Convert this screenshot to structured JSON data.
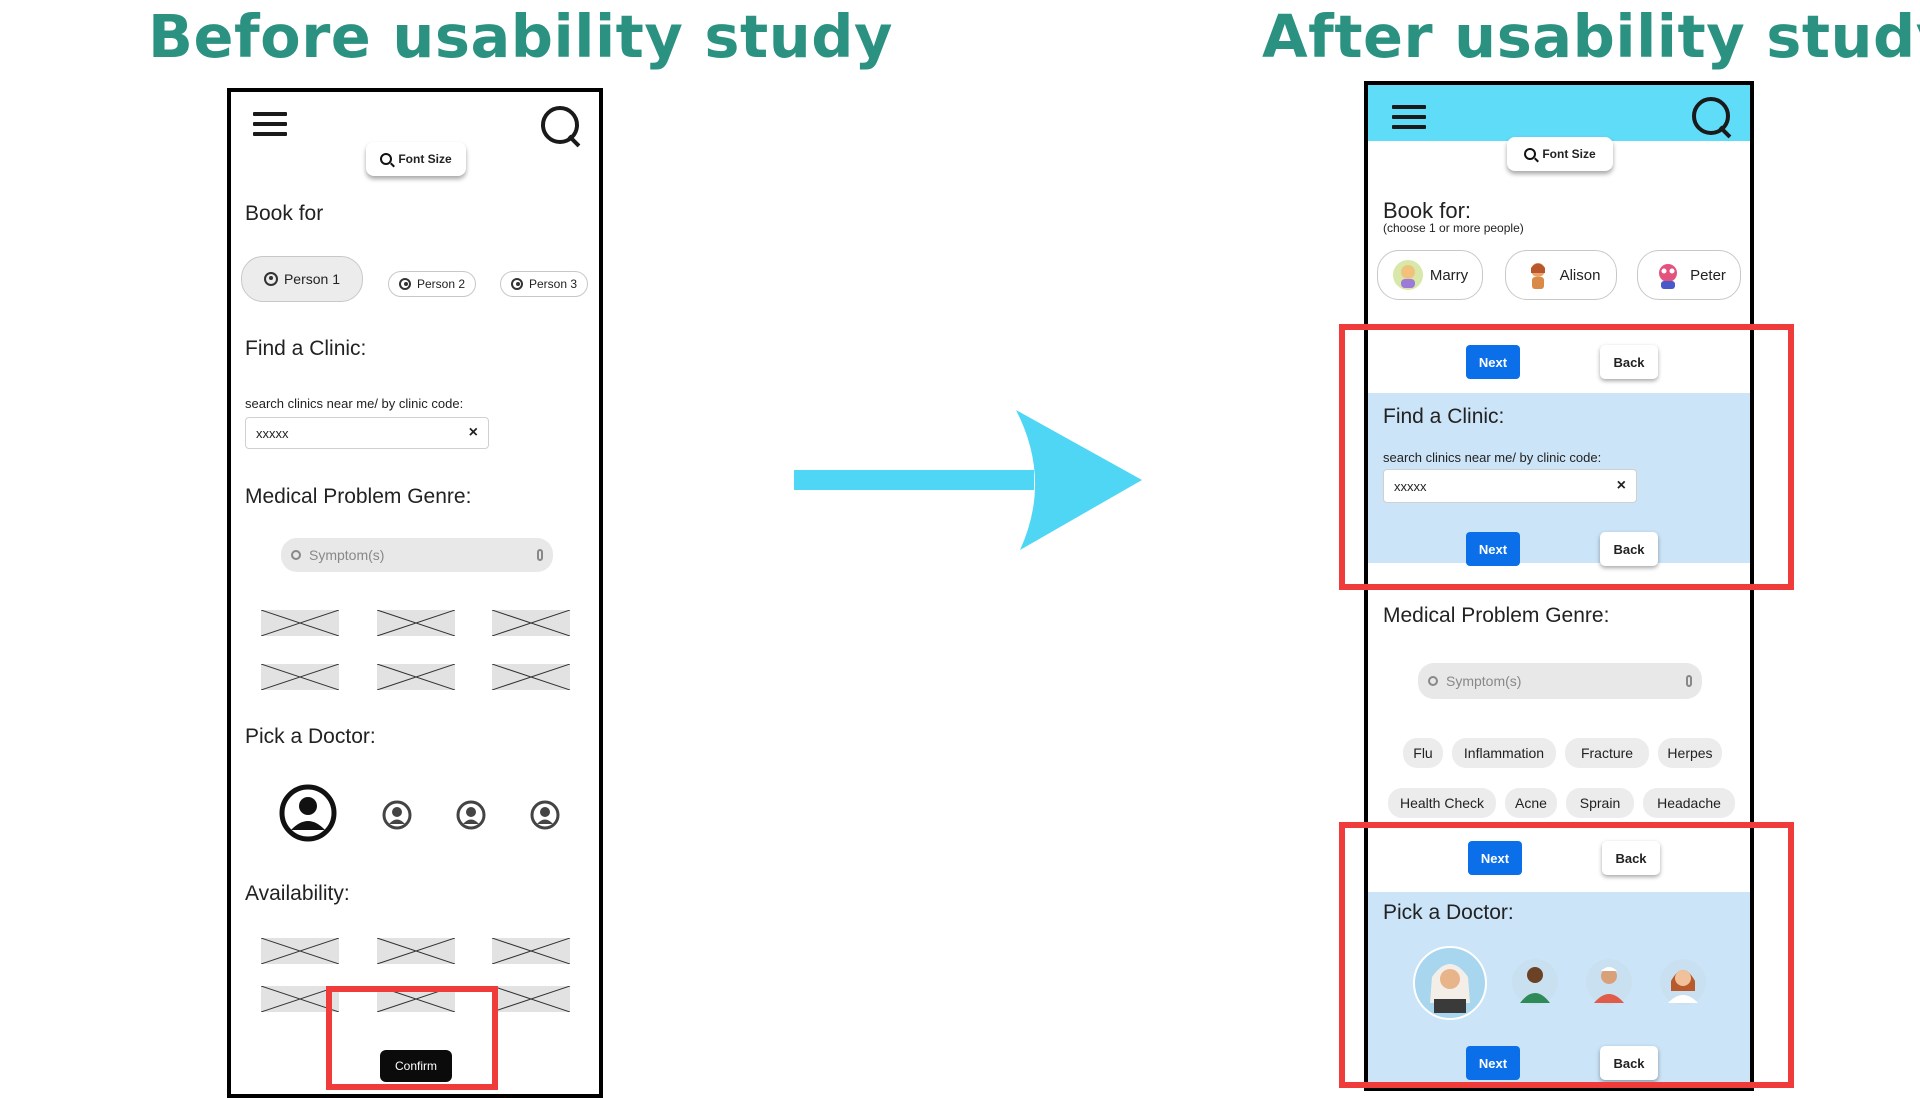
{
  "headings": {
    "before": "Before usability study",
    "after": "After usability study"
  },
  "before": {
    "font_size_label": "Font Size",
    "book_for_title": "Book for",
    "persons": [
      "Person 1",
      "Person 2",
      "Person 3"
    ],
    "find_clinic_title": "Find a Clinic:",
    "clinic_search_label": "search clinics near me/ by clinic code:",
    "clinic_input_value": "xxxxx",
    "clear_symbol": "×",
    "medical_genre_title": "Medical Problem Genre:",
    "symptom_placeholder": "Symptom(s)",
    "pick_doctor_title": "Pick a Doctor:",
    "availability_title": "Availability:",
    "confirm_label": "Confirm"
  },
  "after": {
    "font_size_label": "Font Size",
    "book_for_title": "Book for:",
    "book_for_sub": "(choose 1 or more people)",
    "persons": [
      "Marry",
      "Alison",
      "Peter"
    ],
    "next_label": "Next",
    "back_label": "Back",
    "find_clinic_title": "Find a Clinic:",
    "clinic_search_label": "search clinics near me/ by clinic code:",
    "clinic_input_value": "xxxxx",
    "clear_symbol": "×",
    "medical_genre_title": "Medical Problem Genre:",
    "symptom_placeholder": "Symptom(s)",
    "genres_row1": [
      "Flu",
      "Inflammation",
      "Fracture",
      "Herpes"
    ],
    "genres_row2": [
      "Health Check",
      "Acne",
      "Sprain",
      "Headache"
    ],
    "pick_doctor_title": "Pick a Doctor:"
  },
  "colors": {
    "heading": "#2b9282",
    "arrow": "#4fd6f5",
    "header_bar": "#5fdcf7",
    "highlight": "#f03b3b",
    "next_button": "#0a6fe8",
    "panel": "#cbe4f7"
  },
  "icons": [
    "hamburger-menu-icon",
    "search-icon",
    "zoom-icon",
    "user-icon",
    "mic-icon",
    "arrow-right-icon",
    "image-placeholder-icon"
  ]
}
